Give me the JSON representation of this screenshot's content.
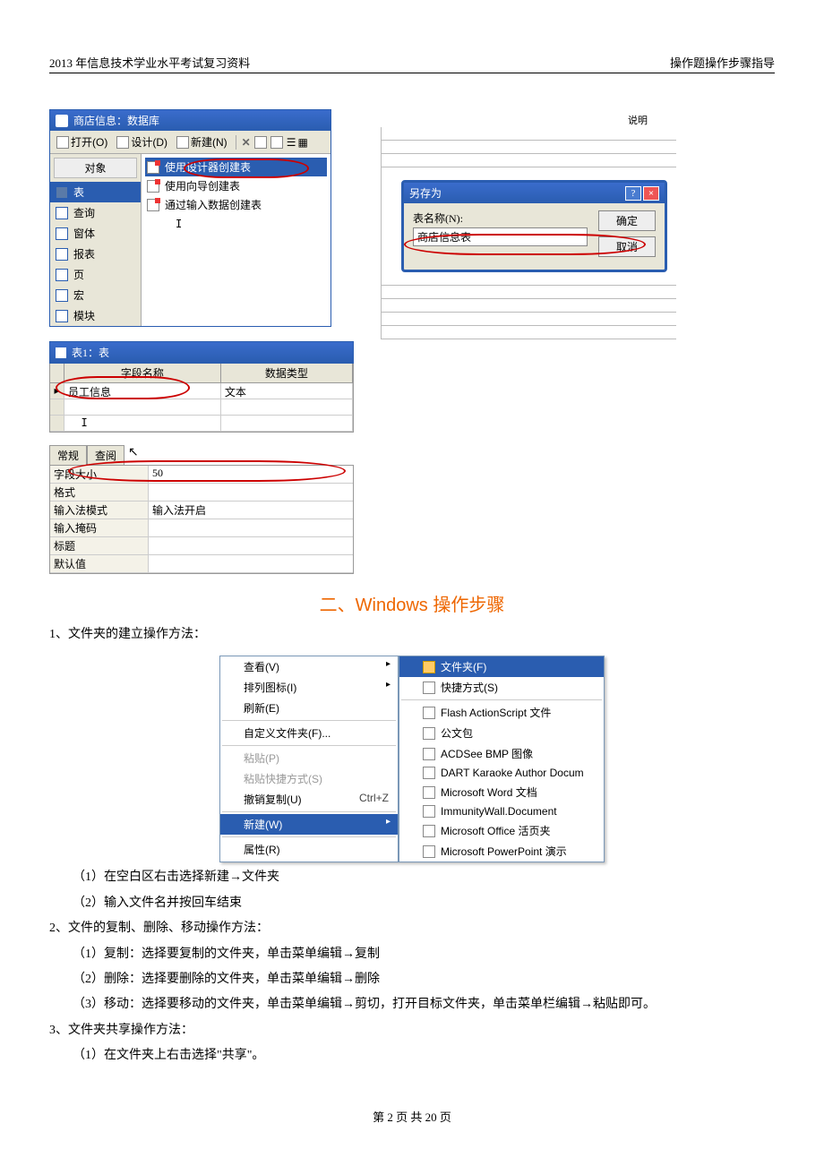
{
  "header": {
    "left": "2013 年信息技术学业水平考试复习资料",
    "right": "操作题操作步骤指导"
  },
  "db_window": {
    "title": "商店信息：数据库",
    "toolbar": {
      "open": "打开(O)",
      "design": "设计(D)",
      "new": "新建(N)"
    },
    "sidebar_header": "对象",
    "sidebar": [
      "表",
      "查询",
      "窗体",
      "报表",
      "页",
      "宏",
      "模块"
    ],
    "main_items": [
      "使用设计器创建表",
      "使用向导创建表",
      "通过输入数据创建表"
    ]
  },
  "saveas": {
    "ruled_label": "说明",
    "title": "另存为",
    "label": "表名称(N):",
    "value": "商店信息表",
    "ok": "确定",
    "cancel": "取消"
  },
  "table_design": {
    "title": "表1：表",
    "col_field": "字段名称",
    "col_type": "数据类型",
    "row_field": "员工信息",
    "row_type": "文本",
    "tab_general": "常规",
    "tab_lookup": "查阅",
    "props": {
      "size_k": "字段大小",
      "size_v": "50",
      "format_k": "格式",
      "ime_k": "输入法模式",
      "ime_v": "输入法开启",
      "mask_k": "输入掩码",
      "caption_k": "标题",
      "default_k": "默认值"
    }
  },
  "section2": {
    "title": "二、Windows 操作步骤",
    "p1": "1、文件夹的建立操作方法：",
    "p1_1": "（1）在空白区右击选择新建→文件夹",
    "p1_2": "（2）输入文件名并按回车结束",
    "p2": "2、文件的复制、删除、移动操作方法：",
    "p2_1": "（1）复制：选择要复制的文件夹，单击菜单编辑→复制",
    "p2_2": "（2）删除：选择要删除的文件夹，单击菜单编辑→删除",
    "p2_3": "（3）移动：选择要移动的文件夹，单击菜单编辑→剪切，打开目标文件夹，单击菜单栏编辑→粘贴即可。",
    "p3": "3、文件夹共享操作方法：",
    "p3_1": "（1）在文件夹上右击选择\"共享\"。"
  },
  "context_menu": {
    "items": [
      {
        "label": "查看(V)",
        "sub": true
      },
      {
        "label": "排列图标(I)",
        "sub": true
      },
      {
        "label": "刷新(E)"
      },
      {
        "sep": true
      },
      {
        "label": "自定义文件夹(F)..."
      },
      {
        "sep": true
      },
      {
        "label": "粘贴(P)",
        "dis": true
      },
      {
        "label": "粘贴快捷方式(S)",
        "dis": true
      },
      {
        "label": "撤销复制(U)",
        "short": "Ctrl+Z"
      },
      {
        "sep": true
      },
      {
        "label": "新建(W)",
        "sub": true,
        "sel": true
      },
      {
        "sep": true
      },
      {
        "label": "属性(R)"
      }
    ],
    "submenu": [
      {
        "label": "文件夹(F)",
        "sel": true,
        "folder": true
      },
      {
        "label": "快捷方式(S)"
      },
      {
        "sep": true
      },
      {
        "label": "Flash ActionScript 文件"
      },
      {
        "label": "公文包"
      },
      {
        "label": "ACDSee BMP 图像"
      },
      {
        "label": "DART Karaoke Author Docum"
      },
      {
        "label": "Microsoft Word 文档"
      },
      {
        "label": "ImmunityWall.Document"
      },
      {
        "label": "Microsoft Office 活页夹"
      },
      {
        "label": "Microsoft PowerPoint 演示"
      }
    ]
  },
  "footer": "第 2 页 共 20 页"
}
